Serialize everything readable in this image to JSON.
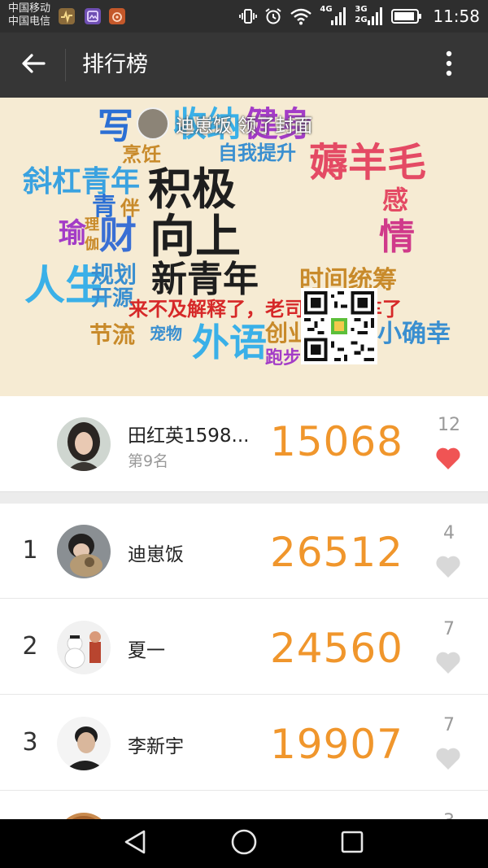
{
  "status_bar": {
    "carrier_1": "中国移动",
    "carrier_2": "中国电信",
    "network_1": "4G",
    "network_2": "3G",
    "network_3": "2G",
    "time": "11:58"
  },
  "app_bar": {
    "title": "排行榜",
    "back_icon": "arrow-left-icon",
    "more_icon": "more-vertical-icon"
  },
  "banner": {
    "cover_claim_text": "迪崽饭 领了封面",
    "words": [
      "写",
      "收纳",
      "健身",
      "烹饪",
      "自我提升",
      "薅羊毛",
      "斜杠青年",
      "青",
      "伴",
      "积极",
      "向上",
      "感",
      "情",
      "理",
      "伽",
      "瑜",
      "财",
      "人生",
      "规划",
      "新青年",
      "时间统筹",
      "开源",
      "节流",
      "来不及解释了，老司机要发车了",
      "宠物",
      "外语",
      "创业",
      "小确幸",
      "跑步"
    ]
  },
  "my_rank": {
    "name": "田红英1598...",
    "rank_text": "第9名",
    "steps": "15068",
    "likes": "12"
  },
  "leaderboard": [
    {
      "rank": "1",
      "name": "迪崽饭",
      "steps": "26512",
      "likes": "4"
    },
    {
      "rank": "2",
      "name": "夏一",
      "steps": "24560",
      "likes": "7"
    },
    {
      "rank": "3",
      "name": "李新宇",
      "steps": "19907",
      "likes": "7"
    },
    {
      "rank": "",
      "name": "",
      "steps": "",
      "likes": "3"
    }
  ],
  "colors": {
    "steps": "#f0962c",
    "heart_liked": "#f05454",
    "heart_unliked": "#d8d8d8",
    "app_bar": "#363636",
    "status_bar": "#2e2e2e"
  },
  "nav_bar": {
    "back_icon": "triangle-back-icon",
    "home_icon": "circle-home-icon",
    "recents_icon": "square-recents-icon"
  }
}
